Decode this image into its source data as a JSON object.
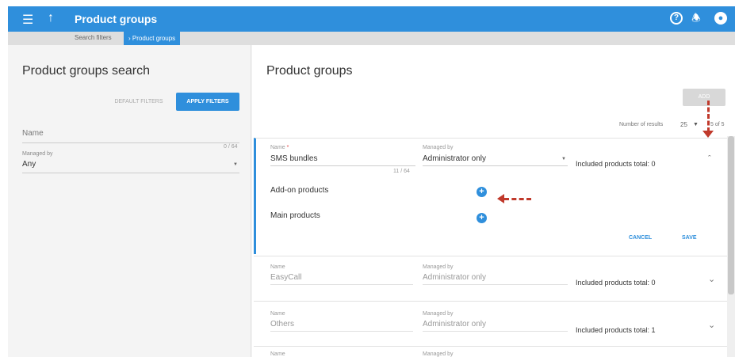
{
  "topbar": {
    "menu_icon": "hamburger-icon",
    "up_icon": "arrow-up-icon",
    "title": "Product groups",
    "icons": [
      "help-icon",
      "bell-icon",
      "user-icon"
    ],
    "accent": "#2f8fdc"
  },
  "breadcrumb": {
    "items": [
      "Search filters",
      "Product groups"
    ],
    "separator": ">"
  },
  "search_panel": {
    "title": "Product groups search",
    "default_filters_label": "DEFAULT FILTERS",
    "apply_filters_label": "APPLY FILTERS",
    "name_placeholder": "Name",
    "name_counter": "0 / 64",
    "managed_by_label": "Managed by",
    "managed_by_value": "Any"
  },
  "results_panel": {
    "title": "Product groups",
    "add_label": "ADD",
    "number_of_results_label": "Number of results",
    "page_size": "25",
    "range_text": "5 of 5",
    "editing_group": {
      "name_label": "Name",
      "required_mark": "*",
      "name_value": "SMS bundles",
      "name_counter": "11 / 64",
      "managed_by_label": "Managed by",
      "managed_by_value": "Administrator only",
      "included_total": "Included products total: 0",
      "addon_label": "Add-on products",
      "main_label": "Main products",
      "cancel_label": "CANCEL",
      "save_label": "SAVE"
    },
    "groups": [
      {
        "name_label": "Name",
        "name": "EasyCall",
        "managed_by_label": "Managed by",
        "managed_by": "Administrator only",
        "total": "Included products total: 0"
      },
      {
        "name_label": "Name",
        "name": "Others",
        "managed_by_label": "Managed by",
        "managed_by": "Administrator only",
        "total": "Included products total: 1"
      },
      {
        "name_label": "Name",
        "managed_by_label": "Managed by"
      }
    ]
  },
  "annotation_color": "#c0392b"
}
